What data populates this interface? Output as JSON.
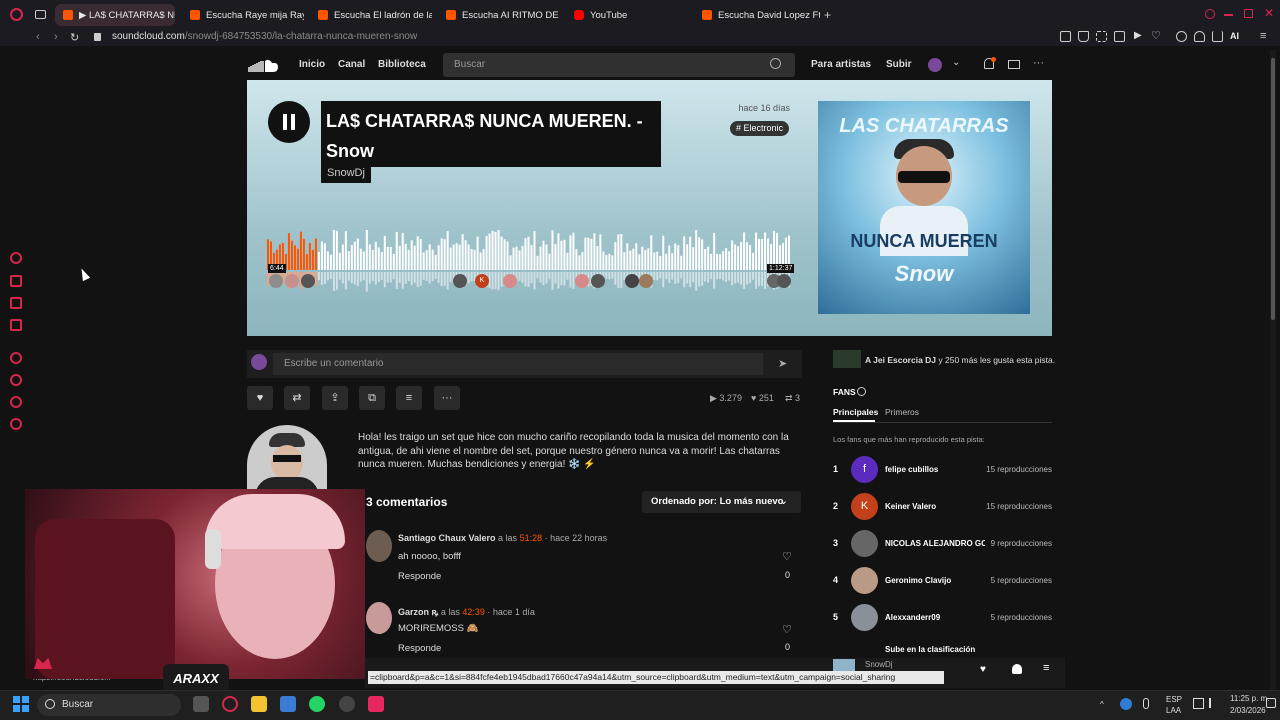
{
  "browser": {
    "tabs": [
      {
        "label": "▶ LA$ CHATARRA$ NU",
        "active": true
      },
      {
        "label": "Escucha Raye mija Raye 2"
      },
      {
        "label": "Escucha El ladrón de la g"
      },
      {
        "label": "Escucha AI RITMO DE - D"
      },
      {
        "label": "YouTube"
      },
      {
        "label": "Escucha David Lopez Ft K"
      }
    ],
    "new_tab": "+",
    "url_host": "soundcloud.com",
    "url_path": "/snowdj-684753530/la-chatarra-nunca-mueren-snow",
    "ai_label": "AI"
  },
  "header": {
    "nav": [
      "Inicio",
      "Canal",
      "Biblioteca"
    ],
    "search_placeholder": "Buscar",
    "right_links": [
      "Para artistas",
      "Subir"
    ]
  },
  "track": {
    "title": "LA$ CHATARRA$ NUNCA MUEREN. - Snow",
    "artist": "SnowDj",
    "date": "hace 16 días",
    "tag": "# Electronic",
    "elapsed": "6:44",
    "duration": "1:12:37",
    "progress_fraction": 0.093
  },
  "artwork": {
    "line1": "LAS CHATARRAS",
    "line2": "NUNCA MUEREN",
    "line3": "Snow"
  },
  "comment_bar": {
    "placeholder": "Escribe un comentario"
  },
  "stats": {
    "plays": "3.279",
    "likes": "251",
    "reposts": "3"
  },
  "description": "Hola! les traigo un set que hice con mucho cariño recopilando toda la musica del momento con la antigua, de ahi viene el nombre del set, porque nuestro género nunca va a morir! Las chatarras nunca mueren. Muchas bendiciones y energia! ❄️ ⚡",
  "comments": {
    "heading": "3 comentarios",
    "sort_label": "Ordenado por: Lo más nuevo",
    "items": [
      {
        "name": "Santiago Chaux Valero",
        "at": "a las",
        "time": "51:28",
        "ago": "· hace 22 horas",
        "text": "ah noooo, bofff",
        "reply": "Responde",
        "likes": "0"
      },
      {
        "name": "Garzon ꝶ",
        "at": "a las",
        "time": "42:39",
        "ago": "· hace 1 día",
        "text": "MORIREMOSS 🙈",
        "reply": "Responde",
        "likes": "0"
      }
    ]
  },
  "likes_info": {
    "liker": "A Jei Escorcia DJ",
    "rest": "y 250 más les gusta esta pista."
  },
  "fans": {
    "heading": "FANS",
    "tabs": [
      "Principales",
      "Primeros"
    ],
    "subtitle": "Los fans que más han reproducido esta pista:",
    "list": [
      {
        "rank": "1",
        "name": "felipe cubillos",
        "plays": "15 reproducciones",
        "color": "#5b2bbf",
        "initial": "f"
      },
      {
        "rank": "2",
        "name": "Keiner Valero",
        "plays": "15 reproducciones",
        "color": "#c2401a",
        "initial": "K"
      },
      {
        "rank": "3",
        "name": "NICOLAS ALEJANDRO GO",
        "plays": "9 reproducciones",
        "color": "#666666",
        "initial": ""
      },
      {
        "rank": "4",
        "name": "Geronimo Clavijo",
        "plays": "5 reproducciones",
        "color": "#b89a86",
        "initial": ""
      },
      {
        "rank": "5",
        "name": "Alexxanderr09",
        "plays": "5 reproducciones",
        "color": "#8a8f99",
        "initial": ""
      }
    ],
    "more": "Sube en la clasificación"
  },
  "player": {
    "artist": "SnowDj"
  },
  "share_url": "=clipboard&p=a&c=1&si=884fcfe4eb1945dbad17660c47a94a14&utm_source=clipboard&utm_medium=text&utm_campaign=social_sharing",
  "status_url": "https://soundcloud.c...",
  "overlay": {
    "logo": "ARAXX"
  },
  "taskbar": {
    "search_placeholder": "Buscar",
    "lang": "ESP",
    "region": "LAA",
    "time": "11:25 p. m.",
    "date": "2/03/2026"
  },
  "colors": {
    "accent": "#ff5500",
    "brand_red": "#d7264c"
  }
}
